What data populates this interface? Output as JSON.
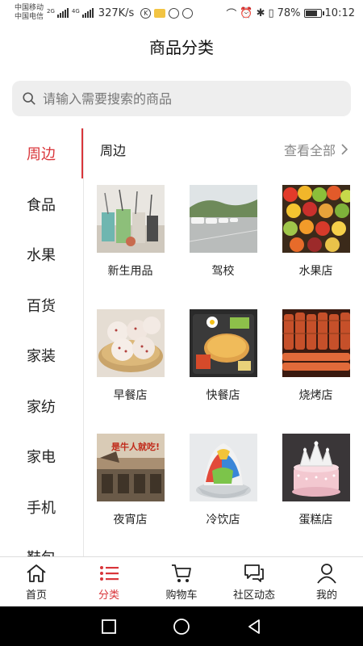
{
  "status_bar": {
    "carrier1": "中国移动",
    "carrier2": "中国电信",
    "net1": "2G",
    "net2": "4G",
    "speed": "327K/s",
    "battery": "78%",
    "time": "10:12",
    "battery_level": 0.78
  },
  "header": {
    "title": "商品分类"
  },
  "search": {
    "placeholder": "请输入需要搜索的商品"
  },
  "sidebar": {
    "items": [
      {
        "label": "周边",
        "active": true
      },
      {
        "label": "食品"
      },
      {
        "label": "水果"
      },
      {
        "label": "百货"
      },
      {
        "label": "家装"
      },
      {
        "label": "家纺"
      },
      {
        "label": "家电"
      },
      {
        "label": "手机"
      },
      {
        "label": "鞋包"
      }
    ]
  },
  "section": {
    "title": "周边",
    "view_all": "查看全部",
    "items": [
      {
        "label": "新生用品",
        "icon": "supplies-photo"
      },
      {
        "label": "驾校",
        "icon": "driving-school-photo"
      },
      {
        "label": "水果店",
        "icon": "fruit-photo"
      },
      {
        "label": "早餐店",
        "icon": "buns-photo"
      },
      {
        "label": "快餐店",
        "icon": "fastfood-photo"
      },
      {
        "label": "烧烤店",
        "icon": "bbq-photo"
      },
      {
        "label": "夜宵店",
        "icon": "night-snack-photo",
        "overlay_text": "是牛人就吃!"
      },
      {
        "label": "冷饮店",
        "icon": "shaved-ice-photo"
      },
      {
        "label": "蛋糕店",
        "icon": "cake-photo"
      }
    ]
  },
  "bottom_nav": {
    "tabs": [
      {
        "label": "首页",
        "icon": "home-icon"
      },
      {
        "label": "分类",
        "icon": "list-icon",
        "active": true
      },
      {
        "label": "购物车",
        "icon": "cart-icon"
      },
      {
        "label": "社区动态",
        "icon": "chat-icon"
      },
      {
        "label": "我的",
        "icon": "user-icon"
      }
    ]
  },
  "colors": {
    "accent": "#d9353a",
    "search_bg": "#eeeeee"
  }
}
